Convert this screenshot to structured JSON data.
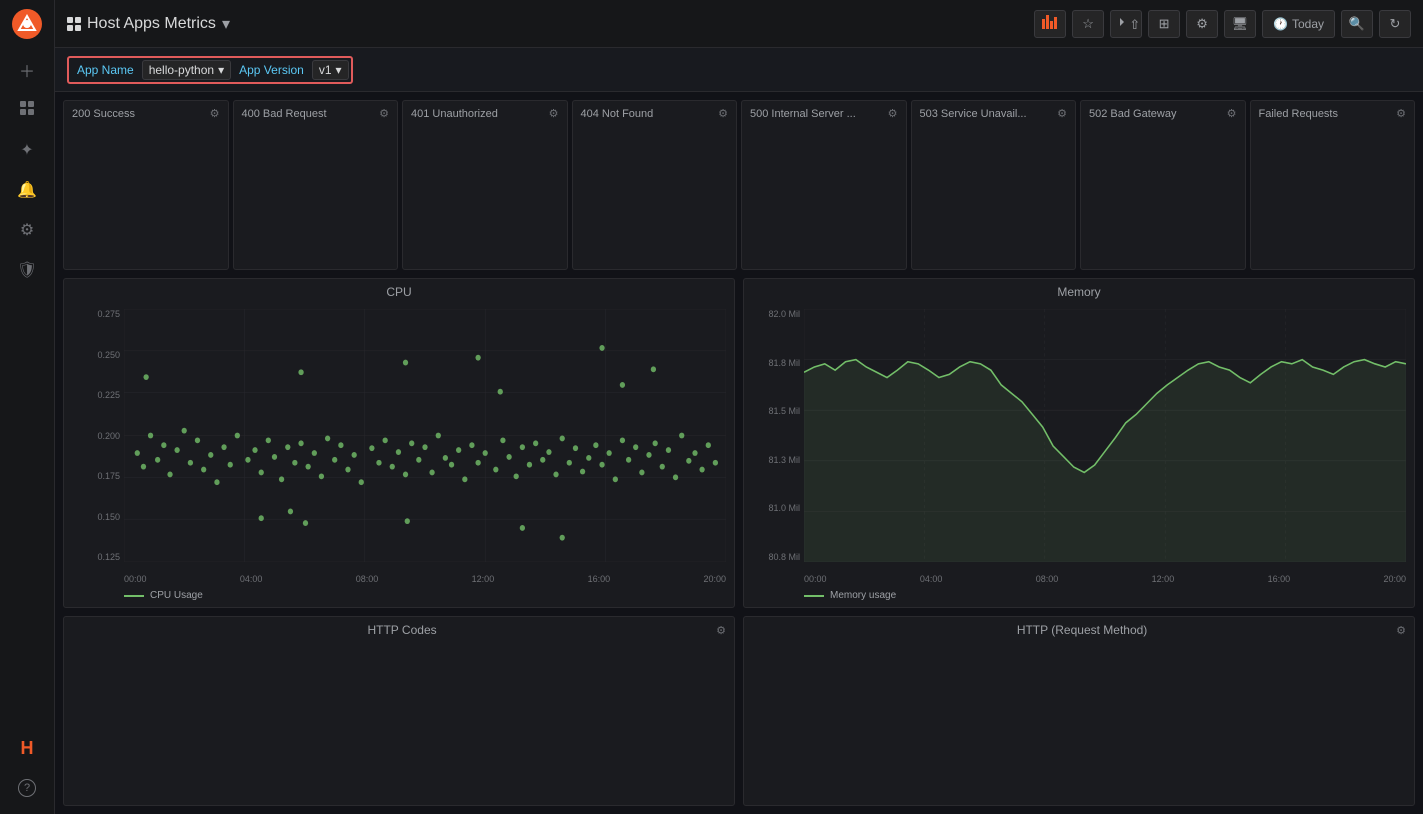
{
  "app": {
    "title": "Host Apps Metrics",
    "title_chevron": "▾"
  },
  "topbar": {
    "graph_icon": "📊",
    "star_label": "☆",
    "share_label": "⇧",
    "layout_label": "⊞",
    "settings_label": "⚙",
    "monitor_label": "🖥",
    "today_label": "Today",
    "search_label": "🔍",
    "refresh_label": "↻"
  },
  "filterbar": {
    "app_name_label": "App Name",
    "app_name_value": "hello-python",
    "app_name_dropdown": "▾",
    "app_version_label": "App Version",
    "app_version_value": "v1",
    "app_version_dropdown": "▾"
  },
  "metrics": [
    {
      "title": "200 Success",
      "id": "m1"
    },
    {
      "title": "400 Bad Request",
      "id": "m2"
    },
    {
      "title": "401 Unauthorized",
      "id": "m3"
    },
    {
      "title": "404 Not Found",
      "id": "m4"
    },
    {
      "title": "500 Internal Server ...",
      "id": "m5"
    },
    {
      "title": "503 Service Unavail...",
      "id": "m6"
    },
    {
      "title": "502 Bad Gateway",
      "id": "m7"
    },
    {
      "title": "Failed Requests",
      "id": "m8"
    }
  ],
  "cpu_chart": {
    "title": "CPU",
    "legend": "CPU Usage",
    "y_labels": [
      "0.275",
      "0.250",
      "0.225",
      "0.200",
      "0.175",
      "0.150",
      "0.125"
    ],
    "x_labels": [
      "00:00",
      "04:00",
      "08:00",
      "12:00",
      "16:00",
      "20:00"
    ]
  },
  "memory_chart": {
    "title": "Memory",
    "legend": "Memory usage",
    "y_labels": [
      "82.0 Mil",
      "81.8 Mil",
      "81.5 Mil",
      "81.3 Mil",
      "81.0 Mil",
      "80.8 Mil"
    ],
    "x_labels": [
      "00:00",
      "04:00",
      "08:00",
      "12:00",
      "16:00",
      "20:00"
    ]
  },
  "bottom_panels": [
    {
      "title": "HTTP Codes",
      "id": "http-codes"
    },
    {
      "title": "HTTP (Request Method)",
      "id": "http-method"
    }
  ],
  "sidebar": {
    "items": [
      {
        "icon": "＋",
        "name": "add"
      },
      {
        "icon": "⊞",
        "name": "dashboard"
      },
      {
        "icon": "✦",
        "name": "explore"
      },
      {
        "icon": "🔔",
        "name": "alerts"
      },
      {
        "icon": "⚙",
        "name": "settings"
      },
      {
        "icon": "🛡",
        "name": "shield"
      }
    ],
    "bottom_items": [
      {
        "icon": "H",
        "name": "help-icon",
        "label": "H"
      },
      {
        "icon": "?",
        "name": "question"
      }
    ]
  }
}
